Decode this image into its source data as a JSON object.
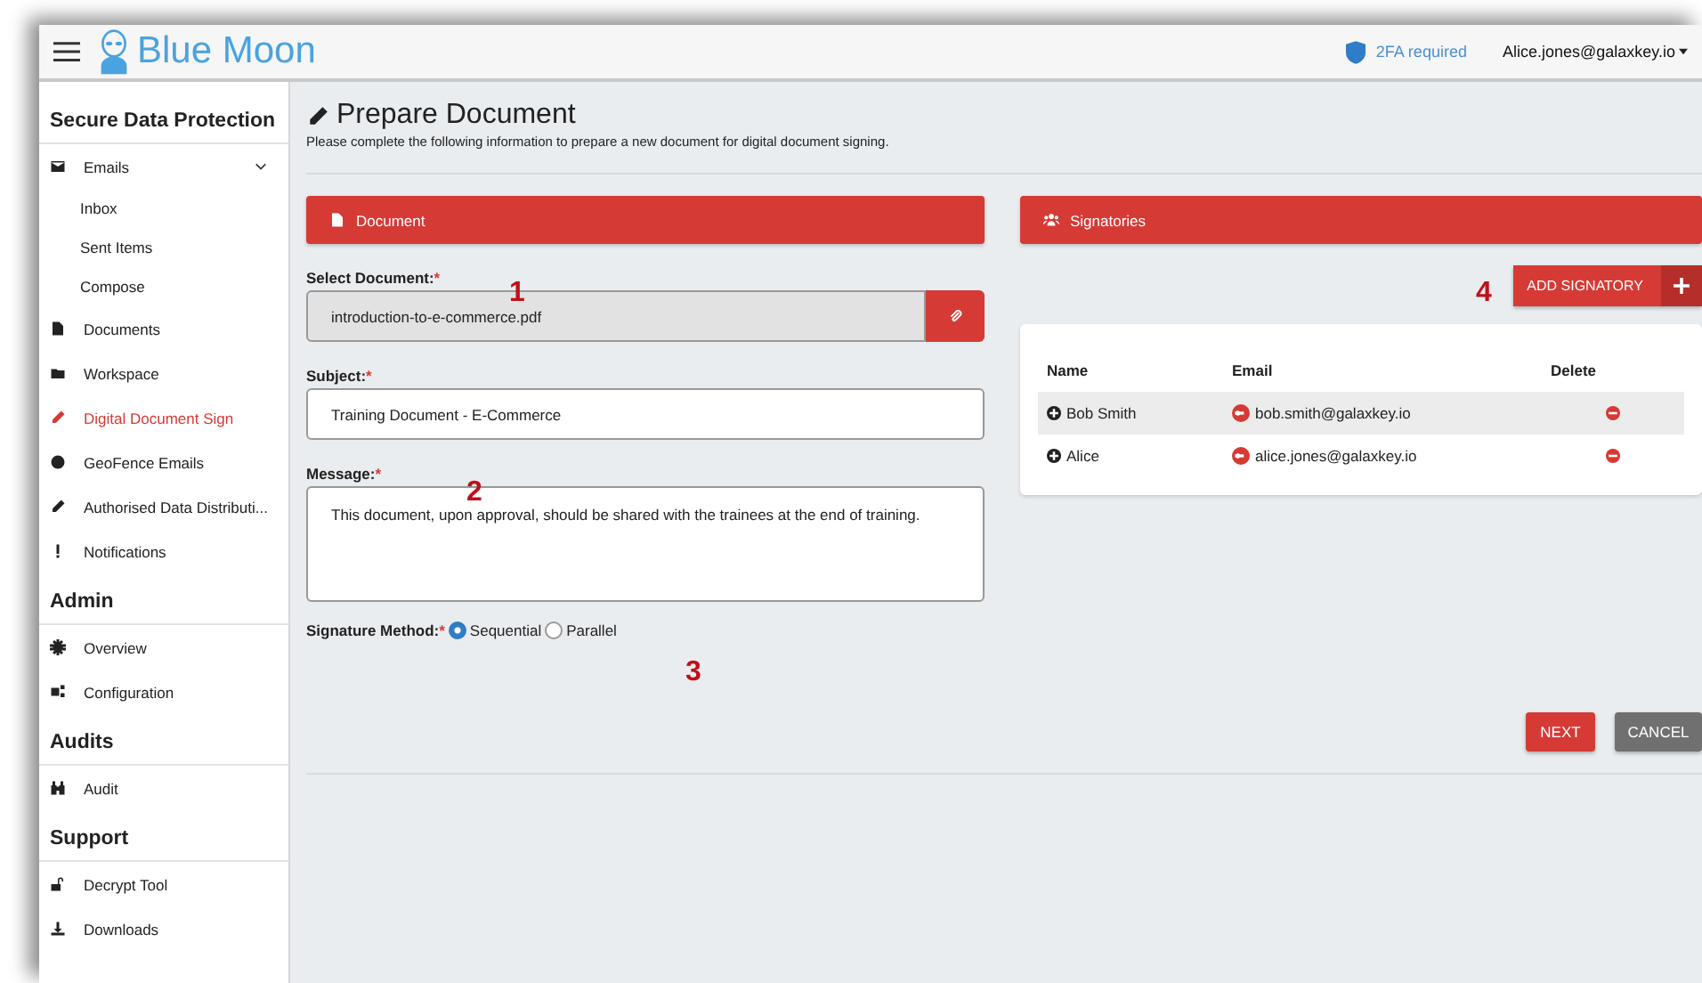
{
  "header": {
    "brand": "Blue Moon",
    "twofa": "2FA required",
    "user": "Alice.jones@galaxkey.io"
  },
  "sidebar": {
    "sections": [
      {
        "title": "Secure Data Protection",
        "items": [
          {
            "label": "Emails",
            "selected": false,
            "expanded": true,
            "children": [
              {
                "label": "Inbox",
                "selected": false
              },
              {
                "label": "Sent Items",
                "selected": false
              },
              {
                "label": "Compose",
                "selected": false
              }
            ]
          },
          {
            "label": "Documents",
            "selected": false
          },
          {
            "label": "Workspace",
            "selected": false
          },
          {
            "label": "Digital Document Sign",
            "selected": true
          },
          {
            "label": "GeoFence Emails",
            "selected": false
          },
          {
            "label": "Authorised Data Distributi...",
            "selected": false
          },
          {
            "label": "Notifications",
            "selected": false
          }
        ]
      },
      {
        "title": "Admin",
        "items": [
          {
            "label": "Overview",
            "selected": false
          },
          {
            "label": "Configuration",
            "selected": false
          }
        ]
      },
      {
        "title": "Audits",
        "items": [
          {
            "label": "Audit",
            "selected": false
          }
        ]
      },
      {
        "title": "Support",
        "items": [
          {
            "label": "Decrypt Tool",
            "selected": false
          },
          {
            "label": "Downloads",
            "selected": false
          }
        ]
      }
    ]
  },
  "page": {
    "title": "Prepare Document",
    "subtitle": "Please complete the following information to prepare a new document for digital document signing."
  },
  "document_panel": {
    "title": "Document",
    "select_label": "Select Document:",
    "required": "*",
    "select_value": "introduction-to-e-commerce.pdf",
    "subject_label": "Subject:",
    "subject_value": "Training Document - E-Commerce",
    "message_label": "Message:",
    "message_value": "This document, upon approval, should be shared with the trainees at the end of training.",
    "method_label": "Signature Method:",
    "methods": [
      {
        "label": "Sequential",
        "selected": true
      },
      {
        "label": "Parallel",
        "selected": false
      }
    ]
  },
  "signatories_panel": {
    "title": "Signatories",
    "add_button": "ADD SIGNATORY",
    "columns": [
      "Name",
      "Email",
      "Delete"
    ],
    "rows": [
      {
        "name": "Bob Smith",
        "email": "bob.smith@galaxkey.io",
        "highlighted": true
      },
      {
        "name": "Alice",
        "email": "alice.jones@galaxkey.io",
        "highlighted": false
      }
    ]
  },
  "buttons": [
    "NEXT",
    "CANCEL"
  ],
  "callouts": [
    "1",
    "2",
    "3",
    "4"
  ]
}
